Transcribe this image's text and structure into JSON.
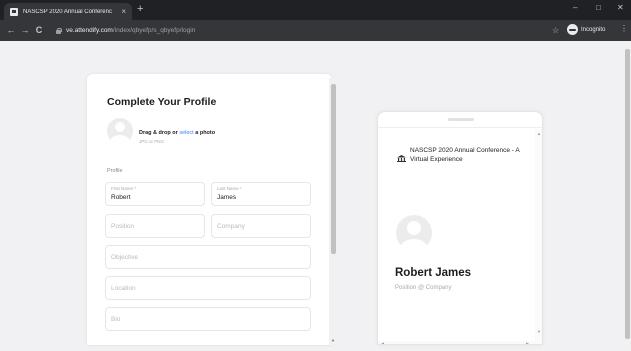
{
  "browser": {
    "tab_title": "NASCSP 2020 Annual Conferenc",
    "tab_close": "×",
    "new_tab": "+",
    "url_host": "ve.attendify.com",
    "url_path": "/index/qbyefp/s_qbyefp/login",
    "profile_label": "Incognito",
    "back": "←",
    "forward": "→",
    "reload": "C",
    "star": "☆",
    "menu": "⋮",
    "minimize": "–",
    "maximize": "□",
    "close": "✕"
  },
  "form": {
    "title": "Complete Your Profile",
    "drop_text_pre": "Drag & drop or ",
    "drop_link": "select",
    "drop_text_post": " a photo",
    "drop_hint": "JPG or PNG",
    "section_label": "Profile",
    "first_name_label": "First Name *",
    "first_name_value": "Robert",
    "last_name_label": "Last Name *",
    "last_name_value": "James",
    "position_placeholder": "Position",
    "company_placeholder": "Company",
    "objective_placeholder": "Objective",
    "location_placeholder": "Location",
    "bio_placeholder": "Bio"
  },
  "preview": {
    "event_title": "NASCSP 2020 Annual Conference - A Virtual Experience",
    "name": "Robert James",
    "subtitle": "Position @ Company"
  },
  "scroll": {
    "up": "▲",
    "down": "▼",
    "left": "◀",
    "right": "▶"
  },
  "colors": {
    "accent": "#3b82f6",
    "chrome_dark": "#202124",
    "chrome_toolbar": "#35363a",
    "page_bg": "#f1f1f3"
  }
}
